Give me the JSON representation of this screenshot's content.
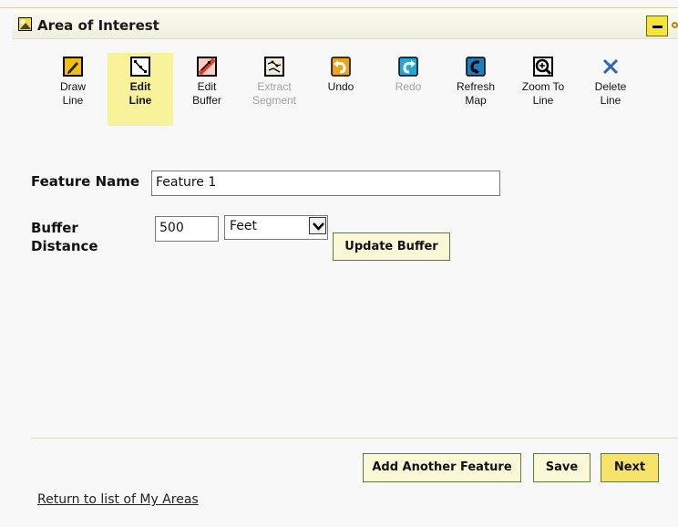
{
  "header": {
    "title": "Area of Interest",
    "app_icon": "aoi-logo-icon",
    "collapse_icon": "minus-icon",
    "pin_icon": "pin-icon"
  },
  "toolbar": {
    "items": [
      {
        "label": "Draw\nLine",
        "icon": "draw-line-icon",
        "state": "normal"
      },
      {
        "label": "Edit\nLine",
        "icon": "edit-line-icon",
        "state": "active"
      },
      {
        "label": "Edit\nBuffer",
        "icon": "edit-buffer-icon",
        "state": "normal"
      },
      {
        "label": "Extract\nSegment",
        "icon": "extract-segment-icon",
        "state": "disabled"
      },
      {
        "label": "Undo",
        "icon": "undo-icon",
        "state": "normal"
      },
      {
        "label": "Redo",
        "icon": "redo-icon",
        "state": "disabled"
      },
      {
        "label": "Refresh\nMap",
        "icon": "refresh-map-icon",
        "state": "normal"
      },
      {
        "label": "Zoom To\nLine",
        "icon": "zoom-to-line-icon",
        "state": "normal"
      },
      {
        "label": "Delete\nLine",
        "icon": "delete-line-icon",
        "state": "normal"
      }
    ]
  },
  "form": {
    "feature_name_label": "Feature Name",
    "feature_name_value": "Feature 1",
    "buffer_label_line1": "Buffer",
    "buffer_label_line2": "Distance",
    "buffer_value": "500",
    "unit_selected": "Feet",
    "update_buffer_label": "Update Buffer"
  },
  "footer": {
    "add_another_label": "Add Another Feature",
    "save_label": "Save",
    "next_label": "Next",
    "return_link": "Return to list of My Areas"
  },
  "colors": {
    "accent_yellow": "#f7e36a",
    "active_tool_bg": "#f8f29a",
    "button_border": "#5e7a3c"
  }
}
